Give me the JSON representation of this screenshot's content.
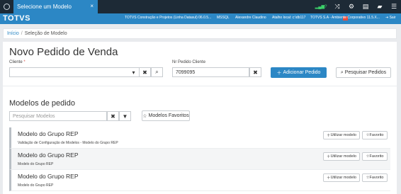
{
  "topbar": {
    "active_tab": "Selecione um Modelo",
    "close_glyph": "×",
    "signal_text": "?",
    "icons": [
      "shuffle-icon",
      "gear-icon",
      "document-icon",
      "chat-icon",
      "menu-icon"
    ]
  },
  "brandbar": {
    "brand": "TOTVS",
    "company": "TOTVS Construção e Projetos (Linha Datasul) 06.0.5...",
    "database": "MSSQL",
    "user": "Alexandre Claudino",
    "server": "Atalho local: c:\\db117",
    "environment": "TOTVS S.A - Ambiente Corporativo 11.5.X...",
    "logout": "Sair"
  },
  "breadcrumb": {
    "home": "Início",
    "separator": "/",
    "current": "Seleção de Modelo"
  },
  "form": {
    "title": "Novo Pedido de Venda",
    "client_label": "Cliente",
    "required_mark": "*",
    "client_value": "",
    "order_label": "Nr Pedido Cliente",
    "order_value": "7099095",
    "add_button": "Adicionar Pedido",
    "search_orders_button": "Pesquisar Pedidos"
  },
  "models": {
    "title": "Modelos de pedido",
    "search_placeholder": "Pesquisar Modelos",
    "favorites_button": "Modelos Favoritos",
    "use_label": "Utilizar modelo",
    "favorite_label": "Favorito",
    "items": [
      {
        "name": "Modelo do Grupo REP",
        "description": "Validação de Configuração de Modelos - Modelo do Grupo REP"
      },
      {
        "name": "Modelo do Grupo REP",
        "description": "Modelo do Grupo REP"
      },
      {
        "name": "Modelo do Grupo REP",
        "description": "Modelo do Grupo REP"
      }
    ]
  },
  "colors": {
    "topbar": "#1d2a36",
    "accent": "#2c87c5",
    "required": "#d9534f",
    "signal": "#3cd06a"
  }
}
